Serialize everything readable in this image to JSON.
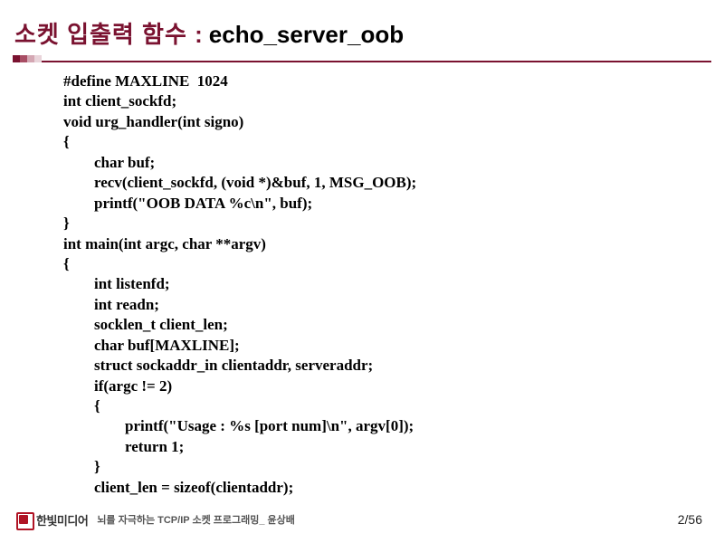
{
  "title": {
    "ko": "소켓 입출력 함수 :",
    "en": "echo_server_oob"
  },
  "code": "#define MAXLINE  1024\nint client_sockfd;\nvoid urg_handler(int signo)\n{\n        char buf;\n        recv(client_sockfd, (void *)&buf, 1, MSG_OOB);\n        printf(\"OOB DATA %c\\n\", buf);\n}\nint main(int argc, char **argv)\n{\n        int listenfd;\n        int readn;\n        socklen_t client_len;\n        char buf[MAXLINE];\n        struct sockaddr_in clientaddr, serveraddr;\n        if(argc != 2)\n        {\n                printf(\"Usage : %s [port num]\\n\", argv[0]);\n                return 1;\n        }\n        client_len = sizeof(clientaddr);",
  "footer": {
    "logo_text": "한빛미디어",
    "subtitle": "뇌를 자극하는 TCP/IP 소켓 프로그래밍_ 윤상배",
    "page": "2/56"
  }
}
